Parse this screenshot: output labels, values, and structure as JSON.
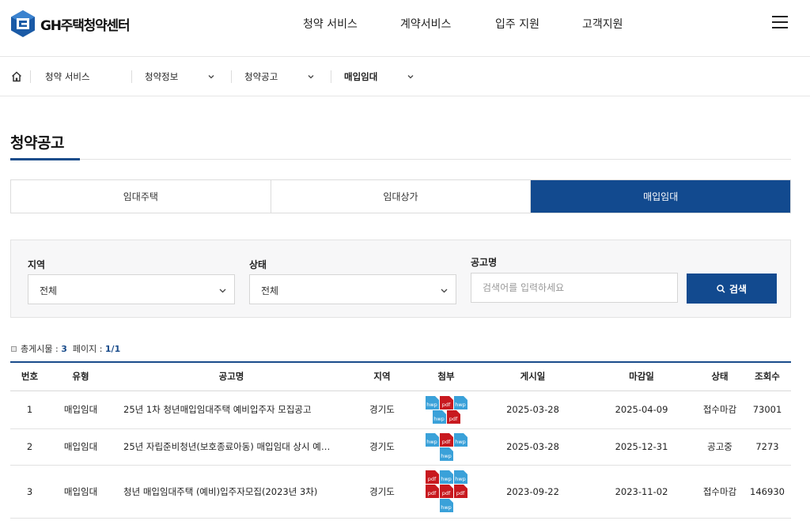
{
  "brand": {
    "name": "GH주택청약센터",
    "primary_color": "#124a8f"
  },
  "gnb": [
    "청약 서비스",
    "계약서비스",
    "입주 지원",
    "고객지원"
  ],
  "breadcrumb": [
    "청약 서비스",
    "청약정보",
    "청약공고",
    "매입임대"
  ],
  "page_title": "청약공고",
  "tabs": [
    {
      "label": "임대주택",
      "active": false
    },
    {
      "label": "임대상가",
      "active": false
    },
    {
      "label": "매입임대",
      "active": true
    }
  ],
  "search": {
    "region_label": "지역",
    "region_value": "전체",
    "status_label": "상태",
    "status_value": "전체",
    "keyword_label": "공고명",
    "keyword_placeholder": "검색어를 입력하세요",
    "button_label": "검색"
  },
  "count": {
    "total_label": "총게시물 :",
    "total": "3",
    "page_label": "페이지 :",
    "page": "1/1"
  },
  "table": {
    "headers": [
      "번호",
      "유형",
      "공고명",
      "지역",
      "첨부",
      "게시일",
      "마감일",
      "상태",
      "조회수"
    ],
    "rows": [
      {
        "no": "1",
        "type": "매입임대",
        "title": "25년 1차 청년매입임대주택 예비입주자 모집공고",
        "region": "경기도",
        "files": [
          "hwp",
          "pdf",
          "hwp",
          "hwp",
          "pdf"
        ],
        "posted": "2025-03-28",
        "deadline": "2025-04-09",
        "status": "접수마감",
        "views": "73001"
      },
      {
        "no": "2",
        "type": "매입임대",
        "title": "25년 자립준비청년(보호종료아동) 매입임대 상시 예…",
        "region": "경기도",
        "files": [
          "hwp",
          "pdf",
          "hwp",
          "hwp"
        ],
        "posted": "2025-03-28",
        "deadline": "2025-12-31",
        "status": "공고중",
        "views": "7273"
      },
      {
        "no": "3",
        "type": "매입임대",
        "title": "청년 매입임대주택 (예비)입주자모집(2023년 3차)",
        "region": "경기도",
        "files": [
          "pdf",
          "hwp",
          "hwp",
          "pdf",
          "pdf",
          "pdf",
          "hwp"
        ],
        "posted": "2023-09-22",
        "deadline": "2023-11-02",
        "status": "접수마감",
        "views": "146930"
      }
    ]
  }
}
